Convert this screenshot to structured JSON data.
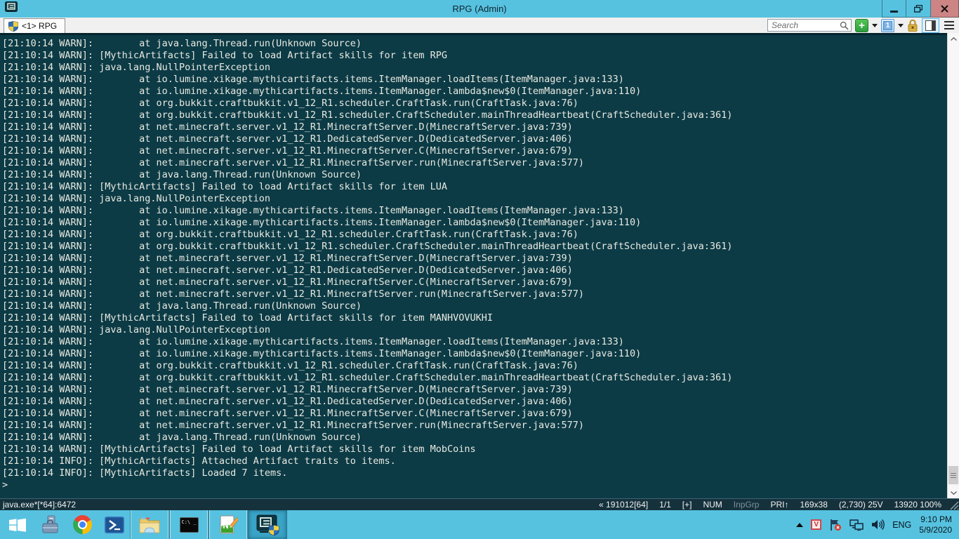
{
  "window": {
    "title": "RPG (Admin)",
    "app": "ConEmu"
  },
  "tab_bar": {
    "tab_label": "<1> RPG",
    "search_placeholder": "Search",
    "console_switch_label": "1"
  },
  "console": {
    "prompt": ">",
    "lines": [
      "[21:10:14 WARN]:        at java.lang.Thread.run(Unknown Source)",
      "[21:10:14 WARN]: [MythicArtifacts] Failed to load Artifact skills for item RPG",
      "[21:10:14 WARN]: java.lang.NullPointerException",
      "[21:10:14 WARN]:        at io.lumine.xikage.mythicartifacts.items.ItemManager.loadItems(ItemManager.java:133)",
      "[21:10:14 WARN]:        at io.lumine.xikage.mythicartifacts.items.ItemManager.lambda$new$0(ItemManager.java:110)",
      "[21:10:14 WARN]:        at org.bukkit.craftbukkit.v1_12_R1.scheduler.CraftTask.run(CraftTask.java:76)",
      "[21:10:14 WARN]:        at org.bukkit.craftbukkit.v1_12_R1.scheduler.CraftScheduler.mainThreadHeartbeat(CraftScheduler.java:361)",
      "[21:10:14 WARN]:        at net.minecraft.server.v1_12_R1.MinecraftServer.D(MinecraftServer.java:739)",
      "[21:10:14 WARN]:        at net.minecraft.server.v1_12_R1.DedicatedServer.D(DedicatedServer.java:406)",
      "[21:10:14 WARN]:        at net.minecraft.server.v1_12_R1.MinecraftServer.C(MinecraftServer.java:679)",
      "[21:10:14 WARN]:        at net.minecraft.server.v1_12_R1.MinecraftServer.run(MinecraftServer.java:577)",
      "[21:10:14 WARN]:        at java.lang.Thread.run(Unknown Source)",
      "[21:10:14 WARN]: [MythicArtifacts] Failed to load Artifact skills for item LUA",
      "[21:10:14 WARN]: java.lang.NullPointerException",
      "[21:10:14 WARN]:        at io.lumine.xikage.mythicartifacts.items.ItemManager.loadItems(ItemManager.java:133)",
      "[21:10:14 WARN]:        at io.lumine.xikage.mythicartifacts.items.ItemManager.lambda$new$0(ItemManager.java:110)",
      "[21:10:14 WARN]:        at org.bukkit.craftbukkit.v1_12_R1.scheduler.CraftTask.run(CraftTask.java:76)",
      "[21:10:14 WARN]:        at org.bukkit.craftbukkit.v1_12_R1.scheduler.CraftScheduler.mainThreadHeartbeat(CraftScheduler.java:361)",
      "[21:10:14 WARN]:        at net.minecraft.server.v1_12_R1.MinecraftServer.D(MinecraftServer.java:739)",
      "[21:10:14 WARN]:        at net.minecraft.server.v1_12_R1.DedicatedServer.D(DedicatedServer.java:406)",
      "[21:10:14 WARN]:        at net.minecraft.server.v1_12_R1.MinecraftServer.C(MinecraftServer.java:679)",
      "[21:10:14 WARN]:        at net.minecraft.server.v1_12_R1.MinecraftServer.run(MinecraftServer.java:577)",
      "[21:10:14 WARN]:        at java.lang.Thread.run(Unknown Source)",
      "[21:10:14 WARN]: [MythicArtifacts] Failed to load Artifact skills for item MANHVOVUKHI",
      "[21:10:14 WARN]: java.lang.NullPointerException",
      "[21:10:14 WARN]:        at io.lumine.xikage.mythicartifacts.items.ItemManager.loadItems(ItemManager.java:133)",
      "[21:10:14 WARN]:        at io.lumine.xikage.mythicartifacts.items.ItemManager.lambda$new$0(ItemManager.java:110)",
      "[21:10:14 WARN]:        at org.bukkit.craftbukkit.v1_12_R1.scheduler.CraftTask.run(CraftTask.java:76)",
      "[21:10:14 WARN]:        at org.bukkit.craftbukkit.v1_12_R1.scheduler.CraftScheduler.mainThreadHeartbeat(CraftScheduler.java:361)",
      "[21:10:14 WARN]:        at net.minecraft.server.v1_12_R1.MinecraftServer.D(MinecraftServer.java:739)",
      "[21:10:14 WARN]:        at net.minecraft.server.v1_12_R1.DedicatedServer.D(DedicatedServer.java:406)",
      "[21:10:14 WARN]:        at net.minecraft.server.v1_12_R1.MinecraftServer.C(MinecraftServer.java:679)",
      "[21:10:14 WARN]:        at net.minecraft.server.v1_12_R1.MinecraftServer.run(MinecraftServer.java:577)",
      "[21:10:14 WARN]:        at java.lang.Thread.run(Unknown Source)",
      "[21:10:14 WARN]: [MythicArtifacts] Failed to load Artifact skills for item MobCoins",
      "[21:10:14 INFO]: [MythicArtifacts] Attached Artifact traits to items.",
      "[21:10:14 INFO]: [MythicArtifacts] Loaded 7 items.",
      ">"
    ]
  },
  "status_bar": {
    "process": "java.exe*[*64]:6472",
    "items": [
      {
        "text": "« 191012[64]",
        "dim": false
      },
      {
        "text": "1/1",
        "dim": false
      },
      {
        "text": "[+]",
        "dim": false
      },
      {
        "text": "NUM",
        "dim": false
      },
      {
        "text": "InpGrp",
        "dim": true
      },
      {
        "text": "PRI↑",
        "dim": false
      },
      {
        "text": "169x38",
        "dim": false
      },
      {
        "text": "(2,730) 25V",
        "dim": false
      },
      {
        "text": "13920 100%",
        "dim": false
      }
    ]
  },
  "taskbar": {
    "tray": {
      "language": "ENG",
      "time": "9:10 PM",
      "date": "5/9/2020"
    }
  },
  "icons": {
    "titlebar_left": "conemu-logo",
    "tab_left": "uac-shield",
    "taskbar": [
      "windows-start",
      "server-manager",
      "chrome",
      "powershell",
      "file-explorer",
      "command-prompt",
      "notepad-plus-plus",
      "conemu-admin"
    ],
    "tray": [
      "show-hidden-arrow",
      "v-app",
      "action-center-flag-error",
      "network",
      "speaker"
    ]
  },
  "colors": {
    "titlebar": "#57c2e0",
    "taskbar": "#57c2e0",
    "console_bg": "#0c3b46",
    "console_fg": "#e9e9e0",
    "statusbar_bg": "#15313c",
    "close_button": "#cd8484",
    "new_console_green": "#3fae49",
    "lock_gold": "#d9a62a"
  }
}
